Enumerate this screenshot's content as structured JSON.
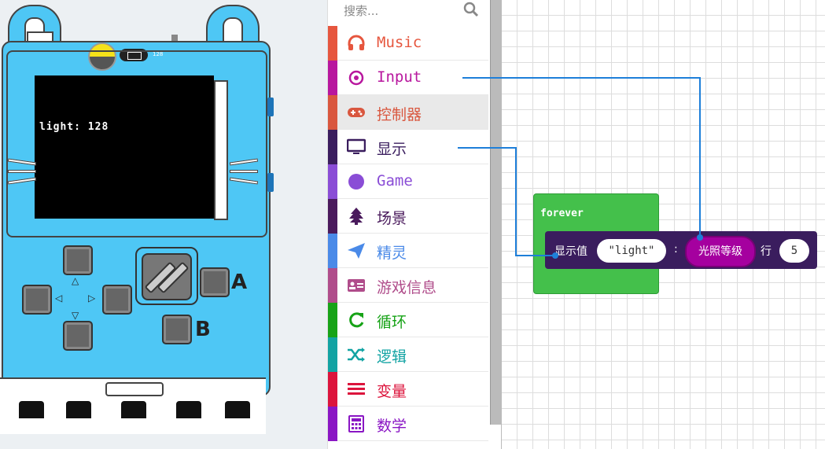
{
  "simulator": {
    "screen_text": "light: 128",
    "battery_value": "128",
    "button_a": "A",
    "button_b": "B"
  },
  "toolbox": {
    "search_placeholder": "搜索...",
    "categories": [
      {
        "label": "Music",
        "icon": "headphones-icon",
        "color": "#e6563e"
      },
      {
        "label": "Input",
        "icon": "input-target-icon",
        "color": "#b8179e"
      },
      {
        "label": "控制器",
        "icon": "gamepad-icon",
        "color": "#d9573f"
      },
      {
        "label": "显示",
        "icon": "monitor-icon",
        "color": "#3a1d5e"
      },
      {
        "label": "Game",
        "icon": "circle-icon",
        "color": "#8a4dd6"
      },
      {
        "label": "场景",
        "icon": "tree-icon",
        "color": "#4a1a5c"
      },
      {
        "label": "精灵",
        "icon": "paper-plane-icon",
        "color": "#4a8ae8"
      },
      {
        "label": "游戏信息",
        "icon": "id-card-icon",
        "color": "#b04d8b"
      },
      {
        "label": "循环",
        "icon": "loop-icon",
        "color": "#17a317"
      },
      {
        "label": "逻辑",
        "icon": "shuffle-icon",
        "color": "#12a3a3"
      },
      {
        "label": "变量",
        "icon": "list-icon",
        "color": "#dc143c"
      },
      {
        "label": "数学",
        "icon": "calculator-icon",
        "color": "#8a16c4"
      }
    ]
  },
  "workspace": {
    "forever_label": "forever",
    "show_value_label": "显示值",
    "string_value": "\"light\"",
    "colon": ":",
    "light_level_label": "光照等级",
    "row_label": "行",
    "row_value": "5"
  }
}
